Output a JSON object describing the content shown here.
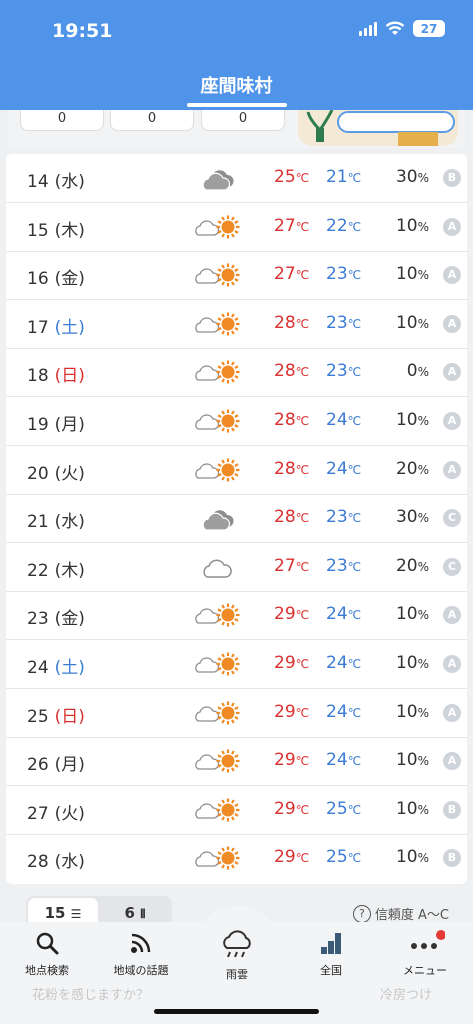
{
  "status": {
    "time": "19:51",
    "battery": "27"
  },
  "header": {
    "title": "座間味村"
  },
  "summary_counts": [
    "0",
    "0",
    "0"
  ],
  "forecast": [
    {
      "day": "14",
      "dow": "(水)",
      "dow_type": "weekday",
      "weather": "cloudy",
      "hi": "25",
      "lo": "21",
      "rain": "30",
      "rel": "B"
    },
    {
      "day": "15",
      "dow": "(木)",
      "dow_type": "weekday",
      "weather": "cloudy-sunny",
      "hi": "27",
      "lo": "22",
      "rain": "10",
      "rel": "A"
    },
    {
      "day": "16",
      "dow": "(金)",
      "dow_type": "weekday",
      "weather": "cloudy-sunny",
      "hi": "27",
      "lo": "23",
      "rain": "10",
      "rel": "A"
    },
    {
      "day": "17",
      "dow": "(土)",
      "dow_type": "sat",
      "weather": "cloudy-sunny",
      "hi": "28",
      "lo": "23",
      "rain": "10",
      "rel": "A"
    },
    {
      "day": "18",
      "dow": "(日)",
      "dow_type": "sun",
      "weather": "cloudy-sunny",
      "hi": "28",
      "lo": "23",
      "rain": "0",
      "rel": "A"
    },
    {
      "day": "19",
      "dow": "(月)",
      "dow_type": "weekday",
      "weather": "cloudy-sunny",
      "hi": "28",
      "lo": "24",
      "rain": "10",
      "rel": "A"
    },
    {
      "day": "20",
      "dow": "(火)",
      "dow_type": "weekday",
      "weather": "cloudy-sunny",
      "hi": "28",
      "lo": "24",
      "rain": "20",
      "rel": "A"
    },
    {
      "day": "21",
      "dow": "(水)",
      "dow_type": "weekday",
      "weather": "cloudy",
      "hi": "28",
      "lo": "23",
      "rain": "30",
      "rel": "C"
    },
    {
      "day": "22",
      "dow": "(木)",
      "dow_type": "weekday",
      "weather": "cloud-light",
      "hi": "27",
      "lo": "23",
      "rain": "20",
      "rel": "C"
    },
    {
      "day": "23",
      "dow": "(金)",
      "dow_type": "weekday",
      "weather": "cloudy-sunny",
      "hi": "29",
      "lo": "24",
      "rain": "10",
      "rel": "A"
    },
    {
      "day": "24",
      "dow": "(土)",
      "dow_type": "sat",
      "weather": "cloudy-sunny",
      "hi": "29",
      "lo": "24",
      "rain": "10",
      "rel": "A"
    },
    {
      "day": "25",
      "dow": "(日)",
      "dow_type": "sun",
      "weather": "cloudy-sunny",
      "hi": "29",
      "lo": "24",
      "rain": "10",
      "rel": "A"
    },
    {
      "day": "26",
      "dow": "(月)",
      "dow_type": "weekday",
      "weather": "cloudy-sunny",
      "hi": "29",
      "lo": "24",
      "rain": "10",
      "rel": "A"
    },
    {
      "day": "27",
      "dow": "(火)",
      "dow_type": "weekday",
      "weather": "cloudy-sunny",
      "hi": "29",
      "lo": "25",
      "rain": "10",
      "rel": "B"
    },
    {
      "day": "28",
      "dow": "(水)",
      "dow_type": "weekday",
      "weather": "cloudy-sunny",
      "hi": "29",
      "lo": "25",
      "rain": "10",
      "rel": "B"
    }
  ],
  "units": {
    "temp": "℃",
    "rain": "%"
  },
  "toggle": {
    "a": "15",
    "b": "6"
  },
  "reliability": {
    "q": "?",
    "label": "信頼度 A～C"
  },
  "nav": [
    {
      "label": "地点検索",
      "icon": "search-icon"
    },
    {
      "label": "地域の話題",
      "icon": "rss-icon"
    },
    {
      "label": "雨雲",
      "icon": "rain-cloud-icon"
    },
    {
      "label": "全国",
      "icon": "chart-bars-icon"
    },
    {
      "label": "メニュー",
      "icon": "more-icon"
    }
  ],
  "under_text": {
    "left": "花粉を感じますか？",
    "right": "冷房つけ"
  },
  "colors": {
    "header": "#4f94e8",
    "hot": "#d9302f",
    "cold": "#3a7bd5"
  }
}
